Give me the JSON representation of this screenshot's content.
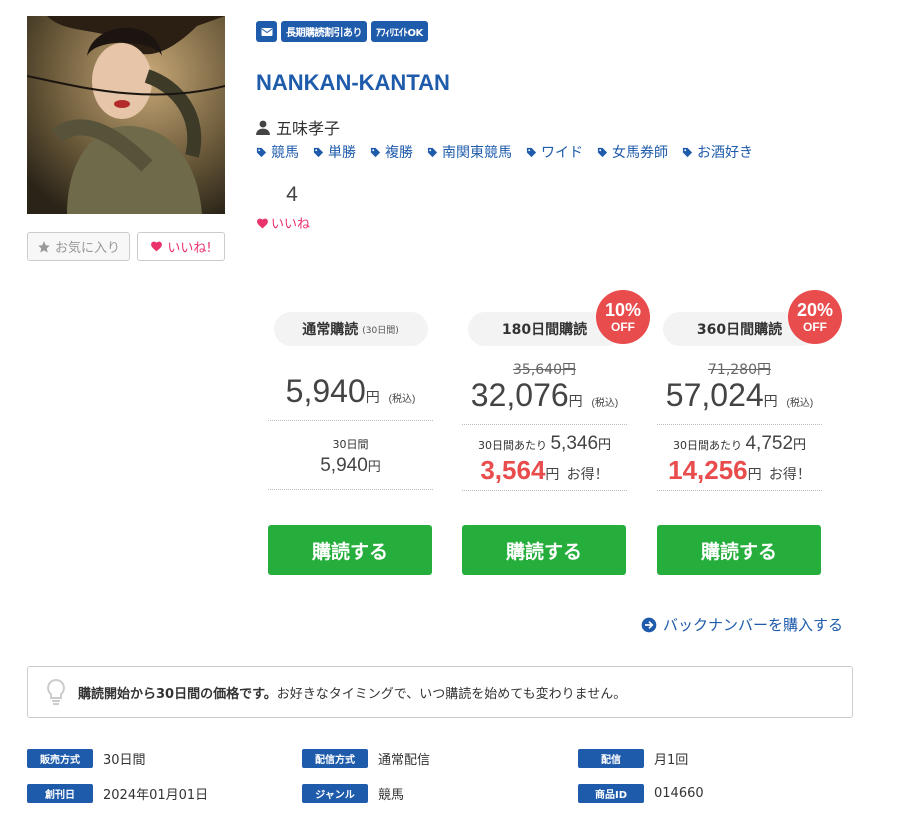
{
  "badges": {
    "mail_icon": "mail-icon",
    "long_term": "長期購読割引あり",
    "affiliate": "ｱﾌｨﾘｴｲﾄOK"
  },
  "title": "NANKAN-KANTAN",
  "author": "五味孝子",
  "tags": [
    "競馬",
    "単勝",
    "複勝",
    "南関東競馬",
    "ワイド",
    "女馬券師",
    "お酒好き"
  ],
  "likes": {
    "count": "4",
    "label": "いいね"
  },
  "buttons": {
    "favorite": "お気に入り",
    "like": "いいね!"
  },
  "plans": [
    {
      "name": "通常購読",
      "sub": "(30日間)",
      "price": "5,940",
      "yen": "円",
      "tax": "(税込)",
      "per_label": "30日間",
      "per_value": "5,940",
      "buy": "購読する"
    },
    {
      "name": "180日間購読",
      "discount_pct": "10%",
      "discount_off": "OFF",
      "original": "35,640円",
      "price": "32,076",
      "yen": "円",
      "tax": "(税込)",
      "per_label": "30日間あたり",
      "per_value": "5,346",
      "save": "3,564",
      "otoku": "お得！",
      "buy": "購読する"
    },
    {
      "name": "360日間購読",
      "discount_pct": "20%",
      "discount_off": "OFF",
      "original": "71,280円",
      "price": "57,024",
      "yen": "円",
      "tax": "(税込)",
      "per_label": "30日間あたり",
      "per_value": "4,752",
      "save": "14,256",
      "otoku": "お得！",
      "buy": "購読する"
    }
  ],
  "backnumber": "バックナンバーを購入する",
  "notice": {
    "bold": "購読開始から30日間の価格です。",
    "rest": "お好きなタイミングで、いつ購読を始めても変わりません。"
  },
  "info": [
    {
      "label": "販売方式",
      "value": "30日間"
    },
    {
      "label": "配信方式",
      "value": "通常配信"
    },
    {
      "label": "配信",
      "value": "月1回"
    },
    {
      "label": "創刊日",
      "value": "2024年01月01日"
    },
    {
      "label": "ジャンル",
      "value": "競馬"
    },
    {
      "label": "商品ID",
      "value": "014660"
    }
  ],
  "colors": {
    "brand": "#1e5bab",
    "buy": "#26ae3c",
    "discount": "#e84c4c",
    "like": "#e8336b"
  }
}
